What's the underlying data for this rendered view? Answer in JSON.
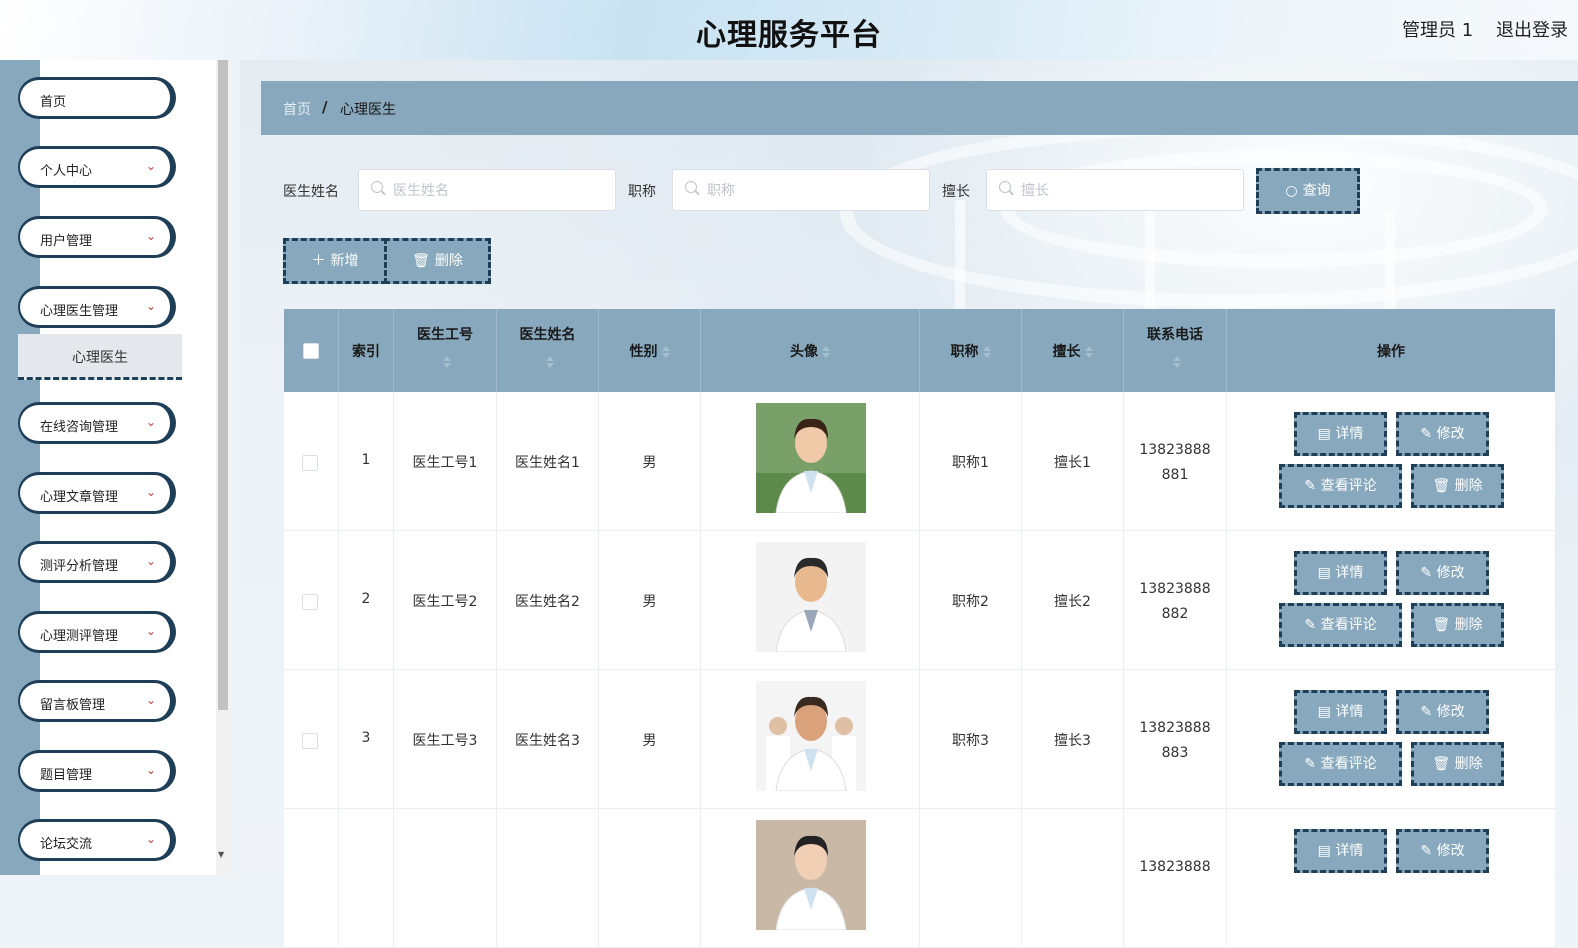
{
  "header": {
    "title": "心理服务平台",
    "user": "管理员 1",
    "logout": "退出登录"
  },
  "sidebar": {
    "items": [
      {
        "label": "首页",
        "chevron": false
      },
      {
        "label": "个人中心",
        "chevron": true
      },
      {
        "label": "用户管理",
        "chevron": true
      },
      {
        "label": "心理医生管理",
        "chevron": true
      },
      {
        "label": "在线咨询管理",
        "chevron": true
      },
      {
        "label": "心理文章管理",
        "chevron": true
      },
      {
        "label": "测评分析管理",
        "chevron": true
      },
      {
        "label": "心理测评管理",
        "chevron": true
      },
      {
        "label": "留言板管理",
        "chevron": true
      },
      {
        "label": "题目管理",
        "chevron": true
      },
      {
        "label": "论坛交流",
        "chevron": true
      }
    ],
    "submenu": "心理医生"
  },
  "breadcrumb": {
    "home": "首页",
    "separator": "/",
    "current": "心理医生"
  },
  "search": {
    "name_label": "医生姓名",
    "name_placeholder": "医生姓名",
    "title_label": "职称",
    "title_placeholder": "职称",
    "specialty_label": "擅长",
    "specialty_placeholder": "擅长",
    "query_button": "查询"
  },
  "actions": {
    "add": "新增",
    "delete": "删除"
  },
  "table": {
    "columns": [
      "索引",
      "医生工号",
      "医生姓名",
      "性别",
      "头像",
      "职称",
      "擅长",
      "联系电话",
      "操作"
    ],
    "rows": [
      {
        "index": "1",
        "id": "医生工号1",
        "name": "医生姓名1",
        "gender": "男",
        "title": "职称1",
        "specialty": "擅长1",
        "phone1": "13823888",
        "phone2": "881"
      },
      {
        "index": "2",
        "id": "医生工号2",
        "name": "医生姓名2",
        "gender": "男",
        "title": "职称2",
        "specialty": "擅长2",
        "phone1": "13823888",
        "phone2": "882"
      },
      {
        "index": "3",
        "id": "医生工号3",
        "name": "医生姓名3",
        "gender": "男",
        "title": "职称3",
        "specialty": "擅长3",
        "phone1": "13823888",
        "phone2": "883"
      },
      {
        "index": "",
        "id": "",
        "name": "",
        "gender": "",
        "title": "",
        "specialty": "",
        "phone1": "13823888",
        "phone2": ""
      }
    ],
    "row_buttons": {
      "detail": "详情",
      "edit": "修改",
      "comments": "查看评论",
      "delete": "删除"
    }
  },
  "colors": {
    "accent": "#87a8bd",
    "border_dark": "#1e3f57"
  }
}
